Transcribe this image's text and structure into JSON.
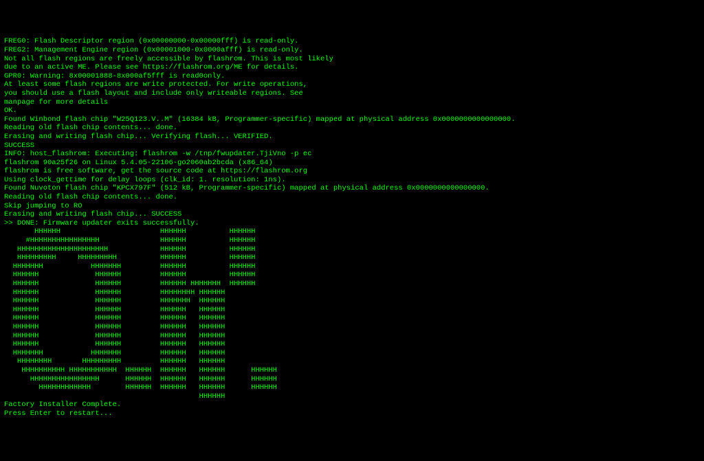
{
  "terminal": {
    "lines": [
      "FREG0: Flash Descriptor region (0x00000000-0x00000fff) is read-only.",
      "FREG2: Management Engine region (0x00001000-0x0000afff) is read-only.",
      "Not all flash regions are freely accessible by flashrom. This is most likely",
      "due to an active ME. Please see https://flashrom.org/ME for details.",
      "GPR0: Warning: 8x00001888-8x000af5fff is read0only.",
      "At least some flash regions are write protected. For write operations,",
      "you should use a flash layout and include only writeable regions. See",
      "manpage for more details",
      "OK.",
      "Found Winbond flash chip \"W25Q123.V..M\" (16384 kB, Programmer-specific) mapped at physical address 0x0000000000000000.",
      "Reading old flash chip contents... done.",
      "Erasing and writing flash chip... Verifying flash... VERIFIED.",
      "SUCCESS",
      "INFO: host_flashrom: Executing: flashrom -w /tnp/fwupdater.TjiVno -p ec",
      "flashrom 90a25f26 on Linux 5.4.05-22106-go2060ab2bcda (x86_64)",
      "flashrom is free software, get the source code at https://flashrom.org",
      "",
      "Using clock_gettime for delay loops (clk_id: 1. resolution: 1ns).",
      "Found Nuvoton flash chip \"KPCX797F\" (512 kB, Programmer-specific) mapped at physical address 0x0000000000000000.",
      "Reading old flash chip contents... done.",
      "Skip jumping to RO",
      "Erasing and writing flash chip... SUCCESS",
      ">> DONE: Firmware updater exits successfully."
    ],
    "ascii_art": [
      "       HHHHHH                       HHHHHH          HHHHHH",
      "     #HHHHHHHHHHHHHHHH              HHHHHH          HHHHHH",
      "   HHHHHHHHHHHHHHHHHHHHH            HHHHHH          HHHHHH",
      "   HHHHHHHHH     HHHHHHHHH          HHHHHH          HHHHHH",
      "  HHHHHHH           HHHHHHH         HHHHHH          HHHHHH",
      "  HHHHHH             HHHHHH         HHHHHH          HHHHHH",
      "  HHHHHH             HHHHHH         HHHHHH HHHHHHH  HHHHHH",
      "  HHHHHH             HHHHHH         HHHHHHHH HHHHHH",
      "  HHHHHH             HHHHHH         HHHHHHH  HHHHHH",
      "  HHHHHH             HHHHHH         HHHHHH   HHHHHH",
      "  HHHHHH             HHHHHH         HHHHHH   HHHHHH",
      "  HHHHHH             HHHHHH         HHHHHH   HHHHHH",
      "  HHHHHH             HHHHHH         HHHHHH   HHHHHH",
      "  HHHHHH             HHHHHH         HHHHHH   HHHHHH",
      "  HHHHHHH           HHHHHHH         HHHHHH   HHHHHH",
      "   HHHHHHHH       HHHHHHHHH         HHHHHH   HHHHHH",
      "    HHHHHHHHHH HHHHHHHHHHH  HHHHHH  HHHHHH   HHHHHH      HHHHHH",
      "      HHHHHHHHHHHHHHHH      HHHHHH  HHHHHH   HHHHHH      HHHHHH",
      "        HHHHHHHHHHHH        HHHHHH  HHHHHH   HHHHHH      HHHHHH",
      "                                             HHHHHH"
    ],
    "footer": [
      "",
      "Factory Installer Complete.",
      "Press Enter to restart..."
    ]
  }
}
